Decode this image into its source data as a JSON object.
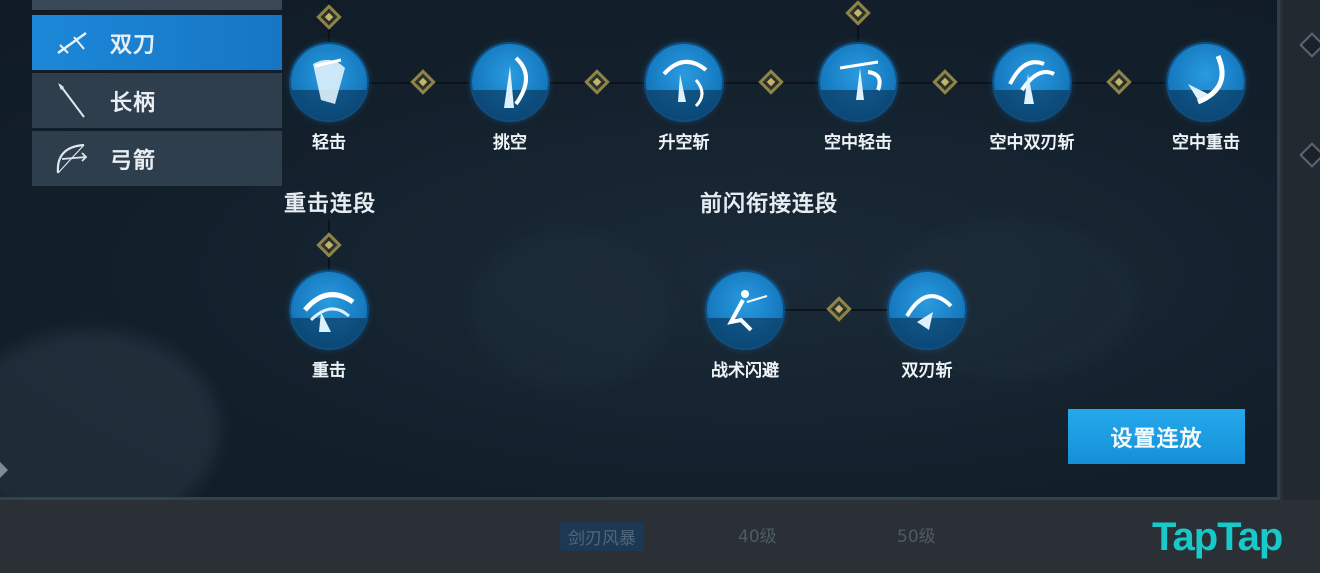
{
  "weapons": [
    {
      "label": "双刀",
      "icon": "dual-blade-icon",
      "active": true
    },
    {
      "label": "长柄",
      "icon": "polearm-icon",
      "active": false
    },
    {
      "label": "弓箭",
      "icon": "bow-icon",
      "active": false
    }
  ],
  "basic_combo": {
    "skills": [
      {
        "label": "轻击"
      },
      {
        "label": "挑空"
      },
      {
        "label": "升空斩"
      },
      {
        "label": "空中轻击"
      },
      {
        "label": "空中双刃斩"
      },
      {
        "label": "空中重击"
      }
    ]
  },
  "heavy_combo": {
    "title": "重击连段",
    "skills": [
      {
        "label": "重击"
      }
    ]
  },
  "dash_combo": {
    "title": "前闪衔接连段",
    "skills": [
      {
        "label": "战术闪避"
      },
      {
        "label": "双刃斩"
      }
    ]
  },
  "actions": {
    "set_combo": "设置连放"
  },
  "bottom": {
    "skill_name": "剑刃风暴",
    "level_1": "40级",
    "level_2": "50级"
  },
  "watermark": "TapTap",
  "colors": {
    "accent": "#1c87d8",
    "gold": "#c2b46a",
    "brand": "#17c9c9"
  }
}
